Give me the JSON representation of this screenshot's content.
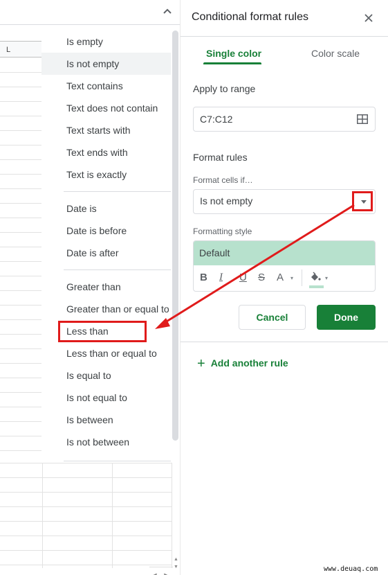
{
  "sheet": {
    "column_header": "L",
    "collapse_icon": "chevron-up-icon"
  },
  "menu": {
    "groups": [
      [
        "Is empty",
        "Is not empty",
        "Text contains",
        "Text does not contain",
        "Text starts with",
        "Text ends with",
        "Text is exactly"
      ],
      [
        "Date is",
        "Date is before",
        "Date is after"
      ],
      [
        "Greater than",
        "Greater than or equal to",
        "Less than",
        "Less than or equal to",
        "Is equal to",
        "Is not equal to",
        "Is between",
        "Is not between"
      ]
    ],
    "hovered_item": "Is not empty",
    "highlighted_item": "Less than"
  },
  "panel": {
    "title": "Conditional format rules",
    "close_icon": "close-icon",
    "tabs": [
      {
        "label": "Single color",
        "active": true
      },
      {
        "label": "Color scale",
        "active": false
      }
    ],
    "apply_to_range_label": "Apply to range",
    "range_value": "C7:C12",
    "format_rules_label": "Format rules",
    "format_cells_if_label": "Format cells if…",
    "condition_value": "Is not empty",
    "formatting_style_label": "Formatting style",
    "style_preview": "Default",
    "toolbar": {
      "bold": "B",
      "italic": "I",
      "underline": "U",
      "strikethrough": "S",
      "text_color": "A"
    },
    "cancel_label": "Cancel",
    "done_label": "Done",
    "add_rule_label": "Add another rule"
  },
  "colors": {
    "accent_green": "#188038",
    "style_preview_bg": "#b7e1cd",
    "annotation_red": "#e01b1b"
  },
  "watermark": "www.deuaq.com"
}
